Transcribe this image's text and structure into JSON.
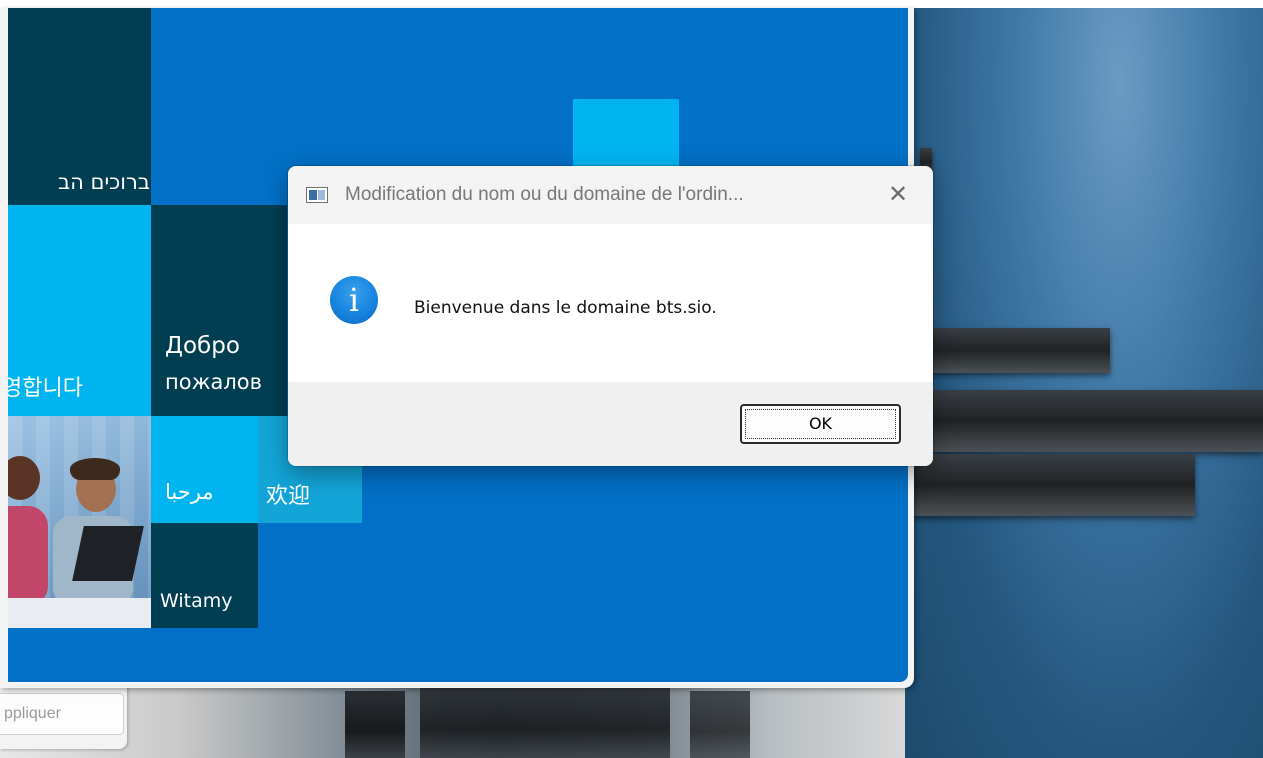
{
  "welcome_art": {
    "greetings": {
      "hebrew": "ברוכים הב",
      "russian_line1": "Добро",
      "russian_line2": "пожалов",
      "korean": "영합니다",
      "arabic": "مرحبا",
      "chinese": "欢迎",
      "polish": "Witamy"
    },
    "colors": {
      "blue": "#0270c6",
      "dark_teal": "#023e52",
      "cyan": "#00b4f0",
      "light_cyan": "#13a5d8"
    }
  },
  "behind_window": {
    "apply_label": "ppliquer"
  },
  "dialog": {
    "title": "Modification du nom ou du domaine de l'ordin...",
    "close_glyph": "✕",
    "info_glyph": "i",
    "message": "Bienvenue dans le domaine bts.sio.",
    "ok_label": "OK"
  }
}
